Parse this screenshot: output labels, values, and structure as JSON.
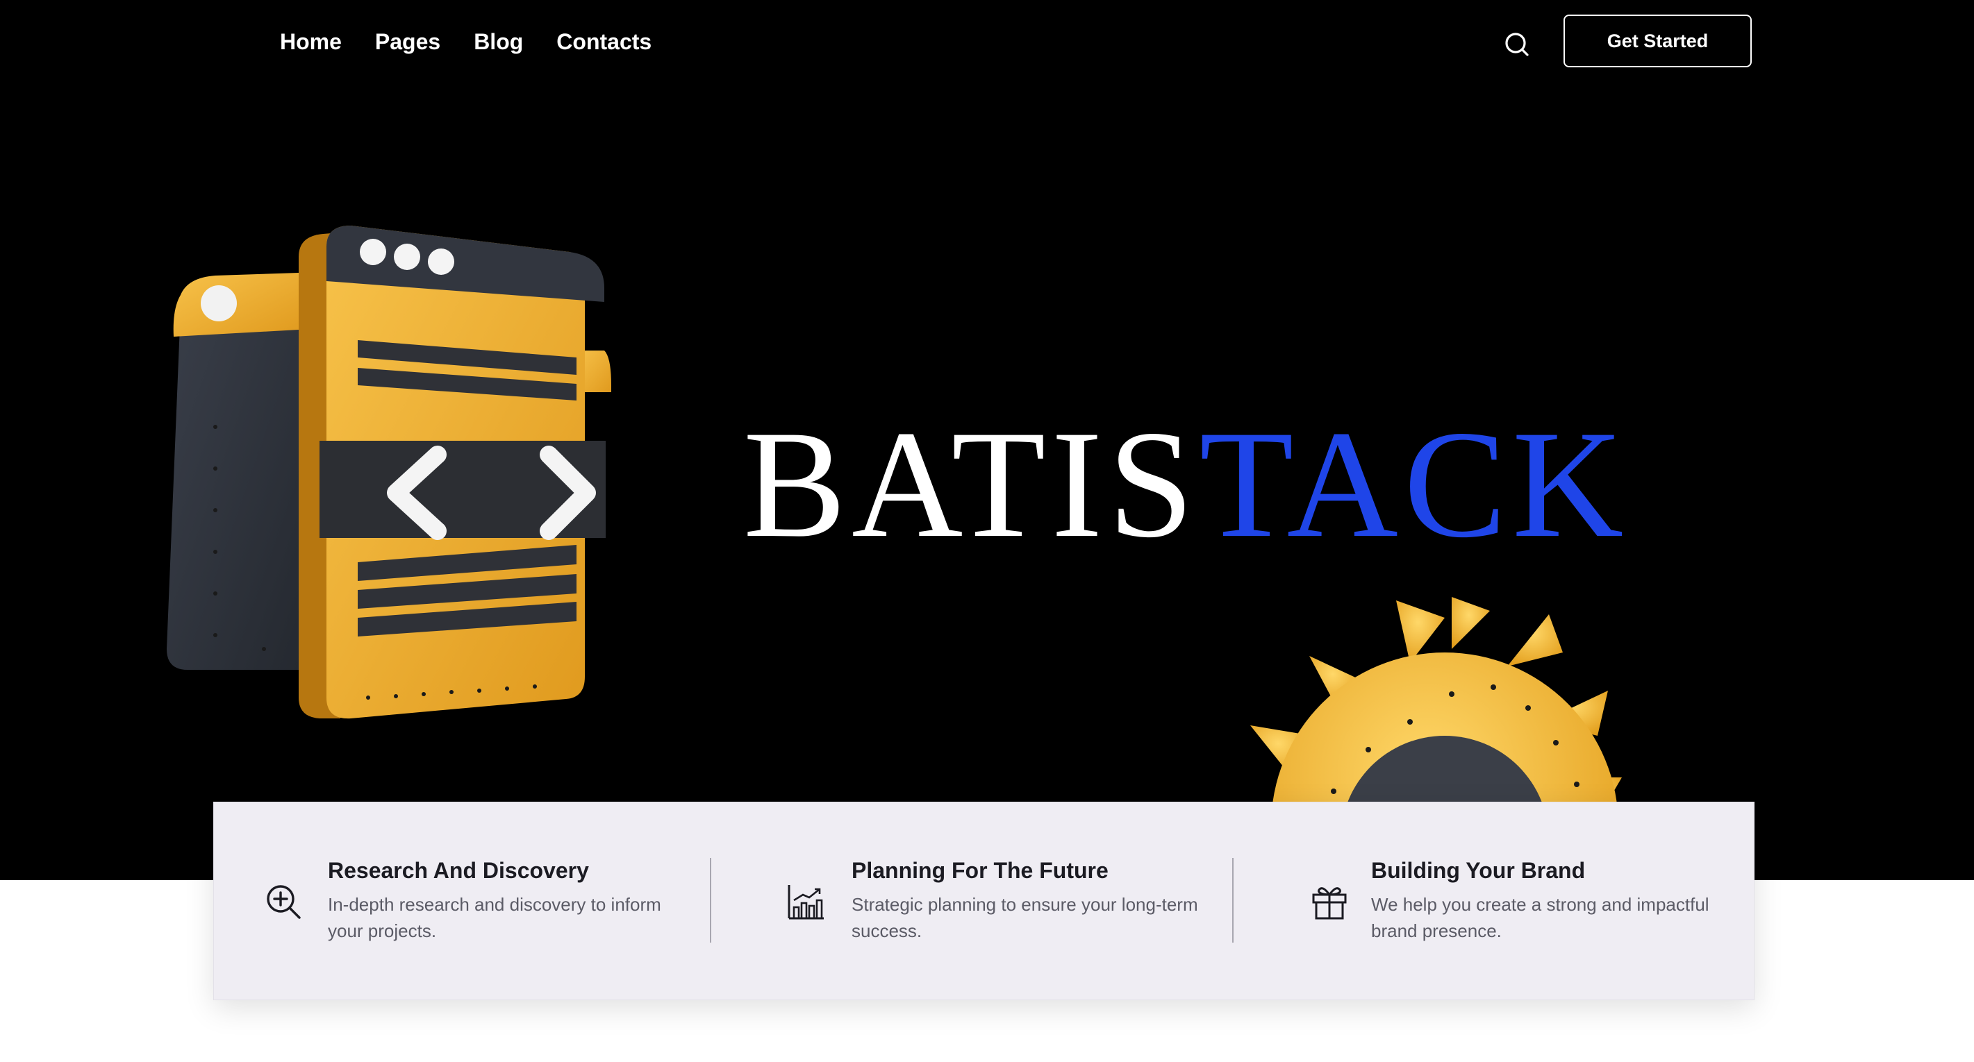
{
  "nav": {
    "links": [
      "Home",
      "Pages",
      "Blog",
      "Contacts"
    ],
    "cta_label": "Get Started"
  },
  "hero": {
    "brand_part_1": "BATIS",
    "brand_part_2": "TACK"
  },
  "features": [
    {
      "icon": "zoom-in-icon",
      "title": "Research And Discovery",
      "description": "In-depth research and discovery to inform your projects."
    },
    {
      "icon": "bar-chart-icon",
      "title": "Planning For The Future",
      "description": "Strategic planning to ensure your long-term success."
    },
    {
      "icon": "gift-icon",
      "title": "Building Your Brand",
      "description": "We help you create a strong and impactful brand presence."
    }
  ],
  "colors": {
    "hero_background": "#000000",
    "brand_accent": "#1f45e8",
    "illustration_yellow": "#f2b632",
    "card_background": "#efedf3"
  }
}
